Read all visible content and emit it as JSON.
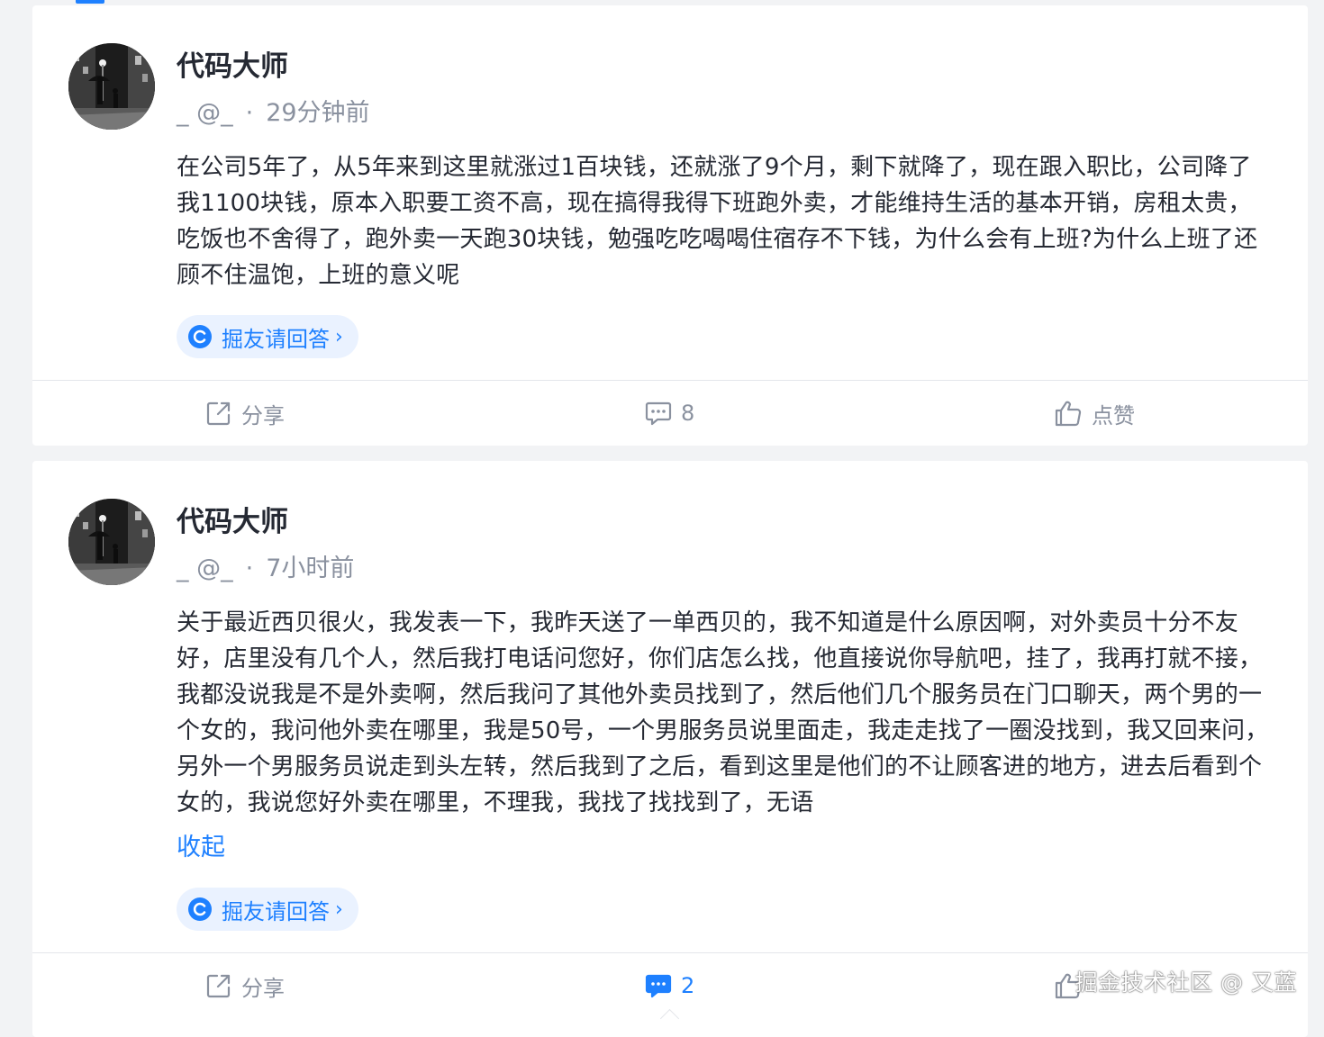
{
  "posts": [
    {
      "author": "代码大师",
      "handle": "_ @_",
      "separator": "·",
      "time": "29分钟前",
      "content": "在公司5年了，从5年来到这里就涨过1百块钱，还就涨了9个月，剩下就降了，现在跟入职比，公司降了我1100块钱，原本入职要工资不高，现在搞得我得下班跑外卖，才能维持生活的基本开销，房租太贵，吃饭也不舍得了，跑外卖一天跑30块钱，勉强吃吃喝喝住宿存不下钱，为什么会有上班?为什么上班了还顾不住温饱，上班的意义呢",
      "answer_button": "掘友请回答",
      "share_label": "分享",
      "comment_count": "8",
      "like_label": "点赞"
    },
    {
      "author": "代码大师",
      "handle": "_ @_",
      "separator": "·",
      "time": "7小时前",
      "content": "关于最近西贝很火，我发表一下，我昨天送了一单西贝的，我不知道是什么原因啊，对外卖员十分不友好，店里没有几个人，然后我打电话问您好，你们店怎么找，他直接说你导航吧，挂了，我再打就不接，我都没说我是不是外卖啊，然后我问了其他外卖员找到了，然后他们几个服务员在门口聊天，两个男的一个女的，我问他外卖在哪里，我是50号，一个男服务员说里面走，我走走找了一圈没找到，我又回来问，另外一个男服务员说走到头左转，然后我到了之后，看到这里是他们的不让顾客进的地方，进去后看到个女的，我说您好外卖在哪里，不理我，我找了找找到了，无语",
      "collapse_label": "收起",
      "answer_button": "掘友请回答",
      "share_label": "分享",
      "comment_count": "2",
      "like_label": "点赞"
    }
  ],
  "watermark": "掘金技术社区 @ 又蓝",
  "colors": {
    "accent": "#1e80ff",
    "muted": "#8a919f",
    "text": "#252933",
    "background": "#f2f3f5"
  }
}
